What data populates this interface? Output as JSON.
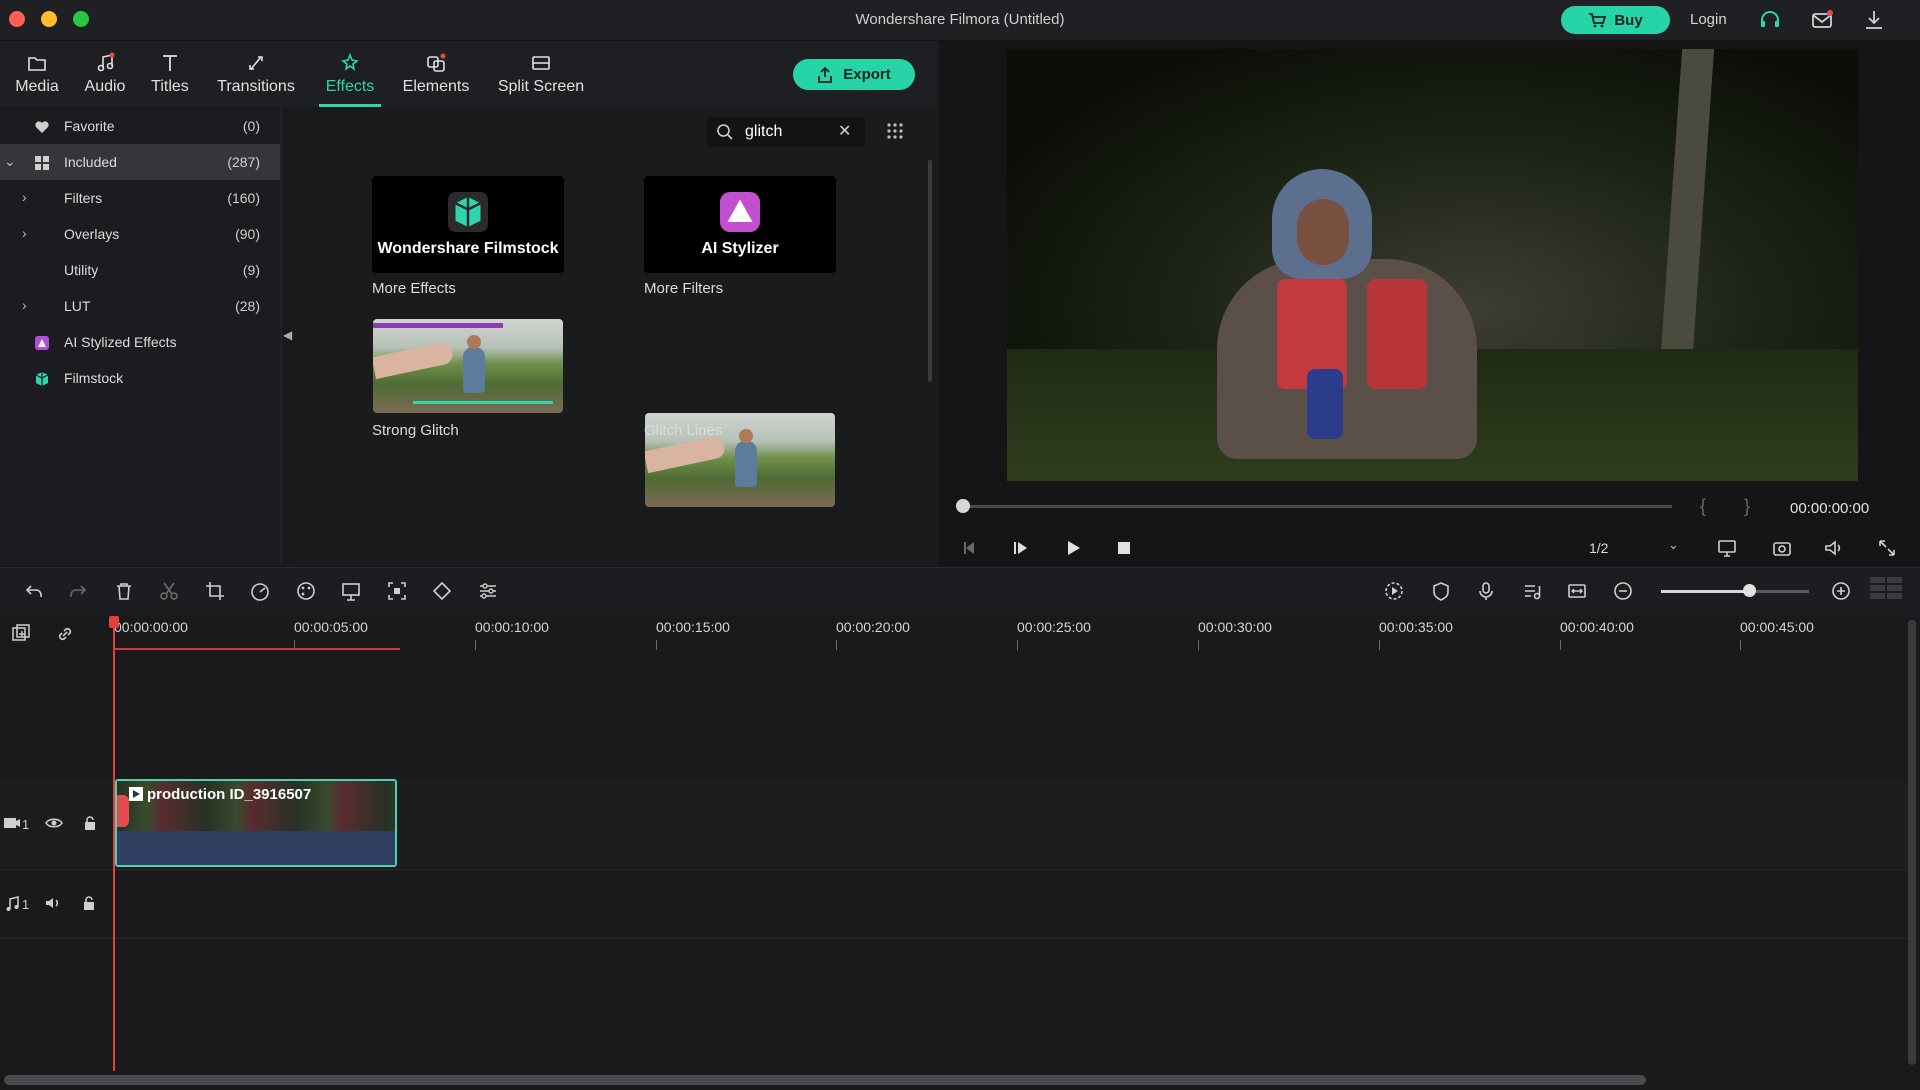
{
  "window": {
    "title": "Wondershare Filmora (Untitled)"
  },
  "topbar": {
    "buy_label": "Buy",
    "login_label": "Login"
  },
  "tabs": [
    {
      "label": "Media",
      "icon": "folder-icon"
    },
    {
      "label": "Audio",
      "icon": "music-note-icon"
    },
    {
      "label": "Titles",
      "icon": "text-t-icon"
    },
    {
      "label": "Transitions",
      "icon": "transition-icon"
    },
    {
      "label": "Effects",
      "icon": "effects-icon",
      "active": true
    },
    {
      "label": "Elements",
      "icon": "elements-icon"
    },
    {
      "label": "Split Screen",
      "icon": "split-screen-icon"
    }
  ],
  "export_label": "Export",
  "sidebar": {
    "items": [
      {
        "label": "Favorite",
        "count": "(0)",
        "icon": "heart-icon"
      },
      {
        "label": "Included",
        "count": "(287)",
        "icon": "grid-icon",
        "selected": true
      },
      {
        "label": "Filters",
        "count": "(160)"
      },
      {
        "label": "Overlays",
        "count": "(90)"
      },
      {
        "label": "Utility",
        "count": "(9)"
      },
      {
        "label": "LUT",
        "count": "(28)"
      },
      {
        "label": "AI Stylized Effects",
        "count": "",
        "icon": "ai-stylizer-icon"
      },
      {
        "label": "Filmstock",
        "count": "",
        "icon": "filmstock-icon"
      }
    ]
  },
  "search": {
    "value": "glitch"
  },
  "effects": {
    "promo": [
      {
        "title": "Wondershare Filmstock",
        "caption": "More Effects"
      },
      {
        "title": "AI Stylizer",
        "caption": "More Filters"
      }
    ],
    "items": [
      {
        "caption": "Strong Glitch"
      },
      {
        "caption": "Glitch Lines"
      },
      {
        "caption": ""
      },
      {
        "caption": ""
      }
    ]
  },
  "preview": {
    "timecode": "00:00:00:00",
    "quality": "1/2",
    "progress": 0
  },
  "timeline": {
    "ruler": [
      "00:00:00:00",
      "00:00:05:00",
      "00:00:10:00",
      "00:00:15:00",
      "00:00:20:00",
      "00:00:25:00",
      "00:00:30:00",
      "00:00:35:00",
      "00:00:40:00",
      "00:00:45:00"
    ],
    "clip_label": "production ID_3916507",
    "video_track_label": "1",
    "audio_track_label": "1",
    "zoom_level": 0.6
  },
  "colors": {
    "accent": "#27d4a8",
    "playhead": "#e0413d",
    "clip_border": "#4fd0b5"
  }
}
